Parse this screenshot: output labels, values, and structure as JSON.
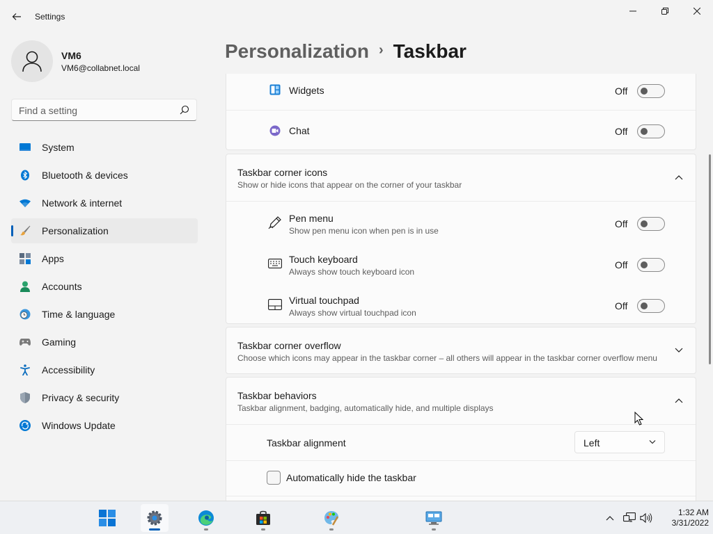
{
  "window": {
    "title": "Settings"
  },
  "profile": {
    "name": "VM6",
    "email": "VM6@collabnet.local"
  },
  "search": {
    "placeholder": "Find a setting"
  },
  "sidebar": {
    "items": [
      {
        "label": "System",
        "icon": "system-icon"
      },
      {
        "label": "Bluetooth & devices",
        "icon": "bluetooth-icon"
      },
      {
        "label": "Network & internet",
        "icon": "wifi-icon"
      },
      {
        "label": "Personalization",
        "icon": "brush-icon",
        "selected": true
      },
      {
        "label": "Apps",
        "icon": "apps-icon"
      },
      {
        "label": "Accounts",
        "icon": "accounts-icon"
      },
      {
        "label": "Time & language",
        "icon": "clock-globe-icon"
      },
      {
        "label": "Gaming",
        "icon": "gamepad-icon"
      },
      {
        "label": "Accessibility",
        "icon": "accessibility-icon"
      },
      {
        "label": "Privacy & security",
        "icon": "shield-icon"
      },
      {
        "label": "Windows Update",
        "icon": "update-icon"
      }
    ]
  },
  "header": {
    "parent": "Personalization",
    "separator": "›",
    "current": "Taskbar"
  },
  "taskbar_items": {
    "widgets": {
      "label": "Widgets",
      "state": "Off"
    },
    "chat": {
      "label": "Chat",
      "state": "Off"
    }
  },
  "corner_icons": {
    "title": "Taskbar corner icons",
    "description": "Show or hide icons that appear on the corner of your taskbar",
    "items": [
      {
        "label": "Pen menu",
        "description": "Show pen menu icon when pen is in use",
        "state": "Off"
      },
      {
        "label": "Touch keyboard",
        "description": "Always show touch keyboard icon",
        "state": "Off"
      },
      {
        "label": "Virtual touchpad",
        "description": "Always show virtual touchpad icon",
        "state": "Off"
      }
    ]
  },
  "corner_overflow": {
    "title": "Taskbar corner overflow",
    "description": "Choose which icons may appear in the taskbar corner – all others will appear in the taskbar corner overflow menu"
  },
  "behaviors": {
    "title": "Taskbar behaviors",
    "description": "Taskbar alignment, badging, automatically hide, and multiple displays",
    "alignment_label": "Taskbar alignment",
    "alignment_value": "Left",
    "autohide_label": "Automatically hide the taskbar"
  },
  "system_tray": {
    "time": "1:32 AM",
    "date": "3/31/2022"
  },
  "colors": {
    "accent": "#005fb8",
    "background": "#f3f3f3",
    "card": "#fbfbfb"
  }
}
